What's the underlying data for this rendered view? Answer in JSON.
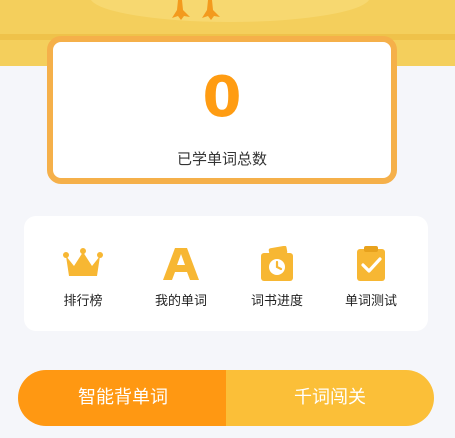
{
  "stats": {
    "total_words_learned": "0",
    "total_words_label": "已学单词总数"
  },
  "menu": {
    "items": [
      {
        "label": "排行榜",
        "icon": "crown-icon"
      },
      {
        "label": "我的单词",
        "icon": "letter-a-icon"
      },
      {
        "label": "词书进度",
        "icon": "book-clock-icon"
      },
      {
        "label": "单词测试",
        "icon": "clipboard-check-icon"
      }
    ]
  },
  "actions": {
    "primary_label": "智能背单词",
    "secondary_label": "千词闯关"
  },
  "colors": {
    "accent_orange": "#ff9812",
    "accent_yellow": "#fbbf38",
    "card_border": "#f5b04a",
    "icon_yellow": "#f7b733",
    "banner": "#f4cf5c"
  }
}
